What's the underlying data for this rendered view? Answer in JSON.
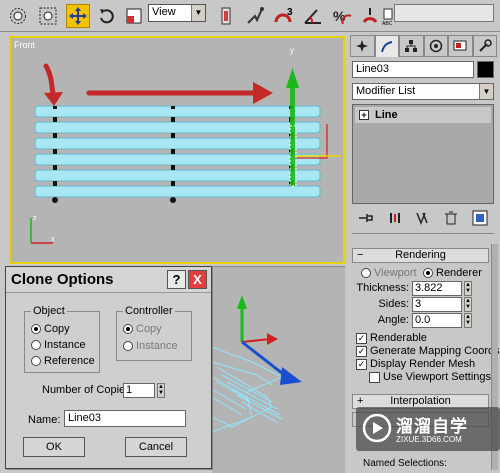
{
  "toolbar": {
    "view_select": "View",
    "icons": [
      "select-circle-icon",
      "select-region-icon",
      "move-icon",
      "rotate-icon",
      "scale-icon",
      "mirror-icon",
      "magnet-icon",
      "angle-snap-icon",
      "percent-snap-icon",
      "spinner-snap-icon",
      "abc-icon"
    ],
    "active_tool": "move-icon"
  },
  "viewport_front": {
    "label": "Front"
  },
  "command_panel": {
    "object_name": "Line03",
    "modifier_list": "Modifier List",
    "stack_item_sign": "+",
    "stack_item": "Line",
    "rendering": {
      "header_sign": "−",
      "header": "Rendering",
      "viewport_label": "Viewport",
      "renderer_label": "Renderer",
      "thickness_label": "Thickness:",
      "thickness_value": "3.822",
      "sides_label": "Sides:",
      "sides_value": "3",
      "angle_label": "Angle:",
      "angle_value": "0.0",
      "renderable_label": "Renderable",
      "gen_mapping_label": "Generate Mapping Coords.",
      "display_mesh_label": "Display Render Mesh",
      "use_viewport_label": "Use Viewport Settings"
    },
    "interpolation": {
      "header_sign": "+",
      "header": "Interpolation"
    },
    "named_selections_label": "Named Selections:"
  },
  "dialog": {
    "title": "Clone Options",
    "help": "?",
    "close": "X",
    "object_group": "Object",
    "object_copy": "Copy",
    "object_instance": "Instance",
    "object_reference": "Reference",
    "controller_group": "Controller",
    "controller_copy": "Copy",
    "controller_instance": "Instance",
    "copies_label": "Number of Copies:",
    "copies_value": "1",
    "name_label": "Name:",
    "name_value": "Line03",
    "ok": "OK",
    "cancel": "Cancel"
  },
  "watermark": {
    "text": "溜溜自学",
    "url": "ZIXUE.3D66.COM"
  },
  "colors": {
    "active_tool": "#f2c200",
    "viewport_border": "#e8d200",
    "slat_fill": "#a9e6f4",
    "annotation_arrow": "#c42828",
    "gizmo_y": "#1bb81b",
    "gizmo_x": "#d02020",
    "gizmo_z": "#1a50d0"
  }
}
